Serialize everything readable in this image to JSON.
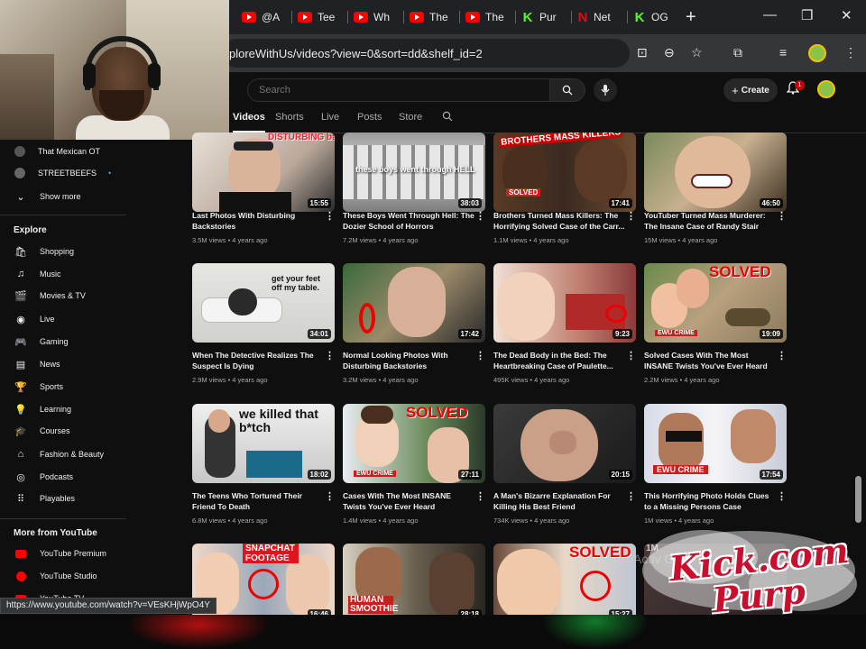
{
  "browser": {
    "tabs": [
      {
        "label": "@A",
        "icon": "youtube-icon"
      },
      {
        "label": "Tee",
        "icon": "youtube-icon"
      },
      {
        "label": "Wh",
        "icon": "youtube-icon"
      },
      {
        "label": "The",
        "icon": "youtube-icon"
      },
      {
        "label": "The",
        "icon": "youtube-icon"
      },
      {
        "label": "Pur",
        "icon": "kick-icon"
      },
      {
        "label": "Net",
        "icon": "netflix-icon"
      },
      {
        "label": "OG",
        "icon": "kick-icon"
      }
    ],
    "new_tab_symbol": "+",
    "minimize_symbol": "—",
    "restore_symbol": "❐",
    "close_symbol": "✕",
    "url": "ploreWithUs/videos?view=0&sort=dd&shelf_id=2",
    "status_url": "https://www.youtube.com/watch?v=VEsKHjWpO4Y"
  },
  "header": {
    "search_placeholder": "Search",
    "create_label": "Create",
    "notification_count": "1"
  },
  "channel_tabs": [
    "Videos",
    "Shorts",
    "Live",
    "Posts",
    "Store"
  ],
  "sidebar": {
    "subscriptions": [
      {
        "label": "That Mexican OT"
      },
      {
        "label": "STREETBEEFS",
        "dot": "•"
      },
      {
        "label": "Show more"
      }
    ],
    "explore_heading": "Explore",
    "explore": [
      {
        "label": "Shopping",
        "icon": "shopping-bag-icon",
        "glyph": "🛍"
      },
      {
        "label": "Music",
        "icon": "music-note-icon",
        "glyph": "♫"
      },
      {
        "label": "Movies & TV",
        "icon": "clapperboard-icon",
        "glyph": "🎬"
      },
      {
        "label": "Live",
        "icon": "live-broadcast-icon",
        "glyph": "◉"
      },
      {
        "label": "Gaming",
        "icon": "gamepad-icon",
        "glyph": "🎮"
      },
      {
        "label": "News",
        "icon": "newspaper-icon",
        "glyph": "▤"
      },
      {
        "label": "Sports",
        "icon": "trophy-icon",
        "glyph": "🏆"
      },
      {
        "label": "Learning",
        "icon": "lightbulb-icon",
        "glyph": "💡"
      },
      {
        "label": "Courses",
        "icon": "graduation-cap-icon",
        "glyph": "🎓"
      },
      {
        "label": "Fashion & Beauty",
        "icon": "hanger-icon",
        "glyph": "⌂"
      },
      {
        "label": "Podcasts",
        "icon": "podcast-icon",
        "glyph": "◎"
      },
      {
        "label": "Playables",
        "icon": "grid-dots-icon",
        "glyph": "⠿"
      }
    ],
    "more_heading": "More from YouTube",
    "more": [
      {
        "label": "YouTube Premium",
        "icon": "youtube-premium-icon"
      },
      {
        "label": "YouTube Studio",
        "icon": "youtube-studio-icon"
      },
      {
        "label": "YouTube TV",
        "icon": "youtube-tv-icon"
      }
    ]
  },
  "videos": [
    {
      "title": "Last Photos With Disturbing Backstories",
      "meta": "3.5M views • 4 years ago",
      "duration": "15:55",
      "overlay": "DISTURBING backstories"
    },
    {
      "title": "These Boys Went Through Hell: The Dozier School of Horrors",
      "meta": "7.2M views • 4 years ago",
      "duration": "38:03",
      "overlay": "these boys went through HELL"
    },
    {
      "title": "Brothers Turned Mass Killers: The Horrifying Solved Case of the Carr...",
      "meta": "1.1M views • 4 years ago",
      "duration": "17:41",
      "overlay": "BROTHERS MASS KILLERS",
      "badge": "SOLVED"
    },
    {
      "title": "YouTuber Turned Mass Murderer: The Insane Case of Randy Stair",
      "meta": "15M views • 4 years ago",
      "duration": "46:50",
      "overlay": ""
    },
    {
      "title": "When The Detective Realizes The Suspect Is Dying",
      "meta": "2.9M views • 4 years ago",
      "duration": "34:01",
      "overlay": "get your feet off my table."
    },
    {
      "title": "Normal Looking Photos With Disturbing Backstories",
      "meta": "3.2M views • 4 years ago",
      "duration": "17:42",
      "overlay": ""
    },
    {
      "title": "The Dead Body in the Bed: The Heartbreaking Case of Paulette...",
      "meta": "495K views • 4 years ago",
      "duration": "9:23",
      "overlay": ""
    },
    {
      "title": "Solved Cases With The Most INSANE Twists You've Ever Heard",
      "meta": "2.2M views • 4 years ago",
      "duration": "19:09",
      "overlay": "SOLVED",
      "badge": "EWU CRIME"
    },
    {
      "title": "The Teens Who Tortured Their Friend To Death",
      "meta": "6.8M views • 4 years ago",
      "duration": "18:02",
      "overlay": "we killed that b*tch"
    },
    {
      "title": "Cases With The Most INSANE Twists You've Ever Heard",
      "meta": "1.4M views • 4 years ago",
      "duration": "27:11",
      "overlay": "SOLVED",
      "badge": "EWU CRIME"
    },
    {
      "title": "A Man's Bizarre Explanation For Killing His Best Friend",
      "meta": "734K views • 4 years ago",
      "duration": "20:15",
      "overlay": ""
    },
    {
      "title": "This Horrifying Photo Holds Clues to a Missing Persons Case",
      "meta": "1M views • 4 years ago",
      "duration": "17:54",
      "overlay": "",
      "badge": "EWU CRIME"
    },
    {
      "title": "",
      "meta": "",
      "duration": "16:46",
      "overlay": "SNAPCHAT FOOTAGE"
    },
    {
      "title": "",
      "meta": "",
      "duration": "28:18",
      "overlay": "HUMAN SMOOTHIE"
    },
    {
      "title": "",
      "meta": "",
      "duration": "15:27",
      "overlay": "SOLVED"
    },
    {
      "title": "",
      "meta": "",
      "duration": "",
      "overlay": "1M"
    }
  ],
  "watermark": {
    "line1": "Kick.com",
    "line2": "Purp"
  },
  "os_overlay": {
    "text": "Activ Go"
  }
}
